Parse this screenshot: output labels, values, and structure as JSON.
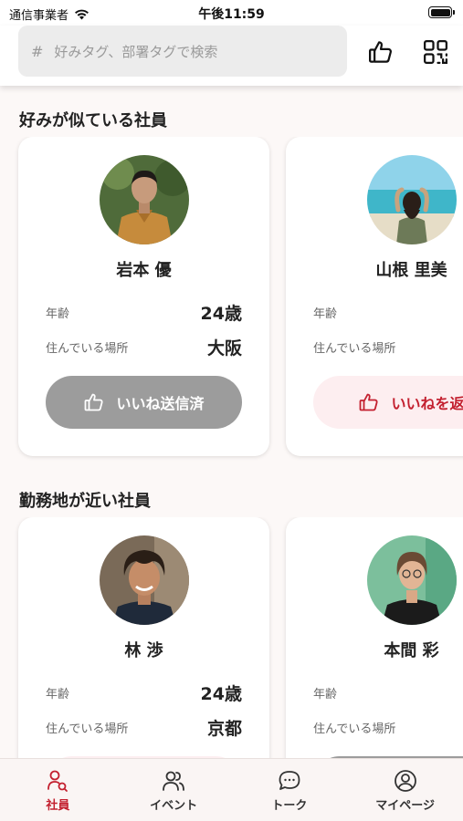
{
  "status": {
    "carrier": "通信事業者",
    "time": "午後11:59"
  },
  "search": {
    "placeholder": "好みタグ、部署タグで検索"
  },
  "sections": [
    {
      "title": "好みが似ている社員",
      "cards": [
        {
          "name": "岩本 優",
          "age_label": "年齢",
          "age": "24歳",
          "location_label": "住んでいる場所",
          "location": "大阪",
          "button_label": "いいね送信済",
          "button_state": "sent"
        },
        {
          "name": "山根 里美",
          "age_label": "年齢",
          "age": "",
          "location_label": "住んでいる場所",
          "location": "",
          "button_label": "いいねを返",
          "button_state": "back"
        }
      ]
    },
    {
      "title": "勤務地が近い社員",
      "cards": [
        {
          "name": "林 渉",
          "age_label": "年齢",
          "age": "24歳",
          "location_label": "住んでいる場所",
          "location": "京都"
        },
        {
          "name": "本間 彩",
          "age_label": "年齢",
          "age": "",
          "location_label": "住んでいる場所",
          "location": ""
        }
      ]
    }
  ],
  "tabs": [
    {
      "label": "社員",
      "icon": "employee-search-icon",
      "active": true
    },
    {
      "label": "イベント",
      "icon": "people-icon",
      "active": false
    },
    {
      "label": "トーク",
      "icon": "chat-bubble-icon",
      "active": false
    },
    {
      "label": "マイページ",
      "icon": "user-circle-icon",
      "active": false
    }
  ],
  "colors": {
    "accent": "#c3202f",
    "sent_button": "#9c9c9c",
    "background": "#fcf8f7"
  }
}
